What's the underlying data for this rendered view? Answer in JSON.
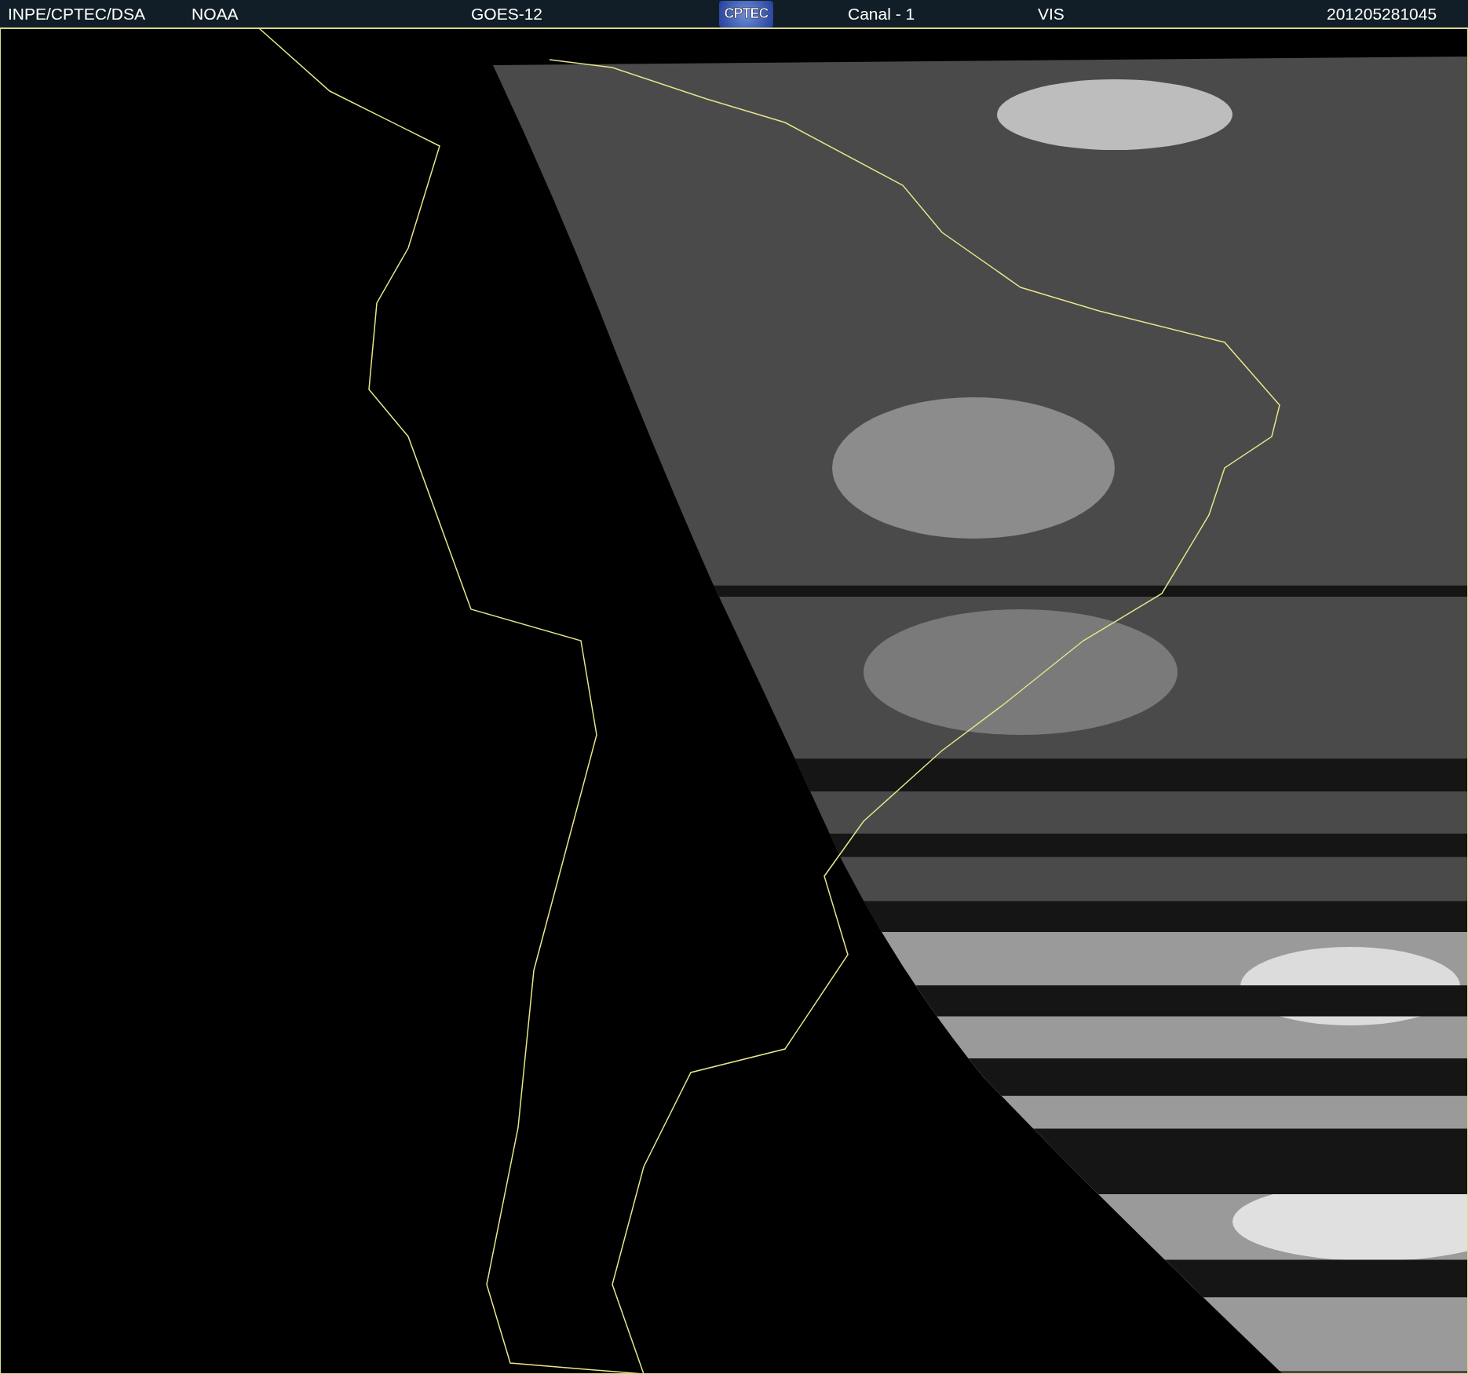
{
  "header": {
    "items": [
      {
        "kind": "text",
        "text": "INPE/CPTEC/DSA"
      },
      {
        "kind": "text",
        "text": "NOAA"
      },
      {
        "kind": "text",
        "text": "GOES-12"
      },
      {
        "kind": "logo",
        "text": "CPTEC"
      },
      {
        "kind": "text",
        "text": "Canal - 1"
      },
      {
        "kind": "text",
        "text": "VIS"
      },
      {
        "kind": "text",
        "text": "201205281045"
      }
    ]
  }
}
